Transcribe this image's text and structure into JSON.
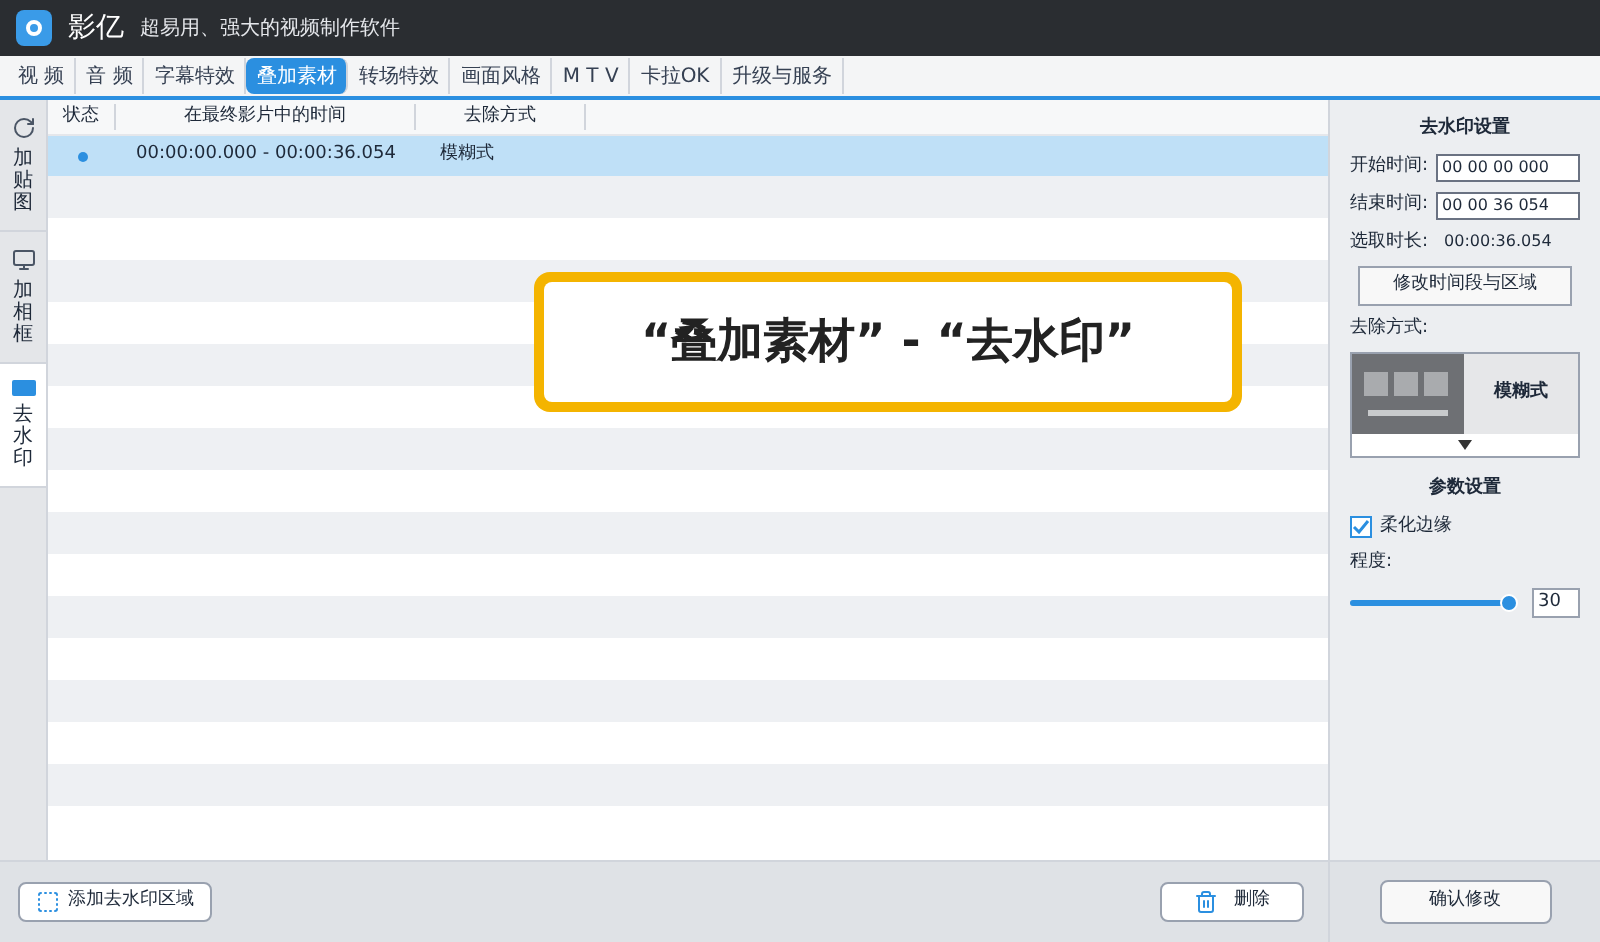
{
  "window": {
    "title": "影亿",
    "subtitle": "超易用、强大的视频制作软件"
  },
  "tabs": [
    {
      "label": "视 频",
      "selected": false
    },
    {
      "label": "音 频",
      "selected": false
    },
    {
      "label": "字幕特效",
      "selected": false
    },
    {
      "label": "叠加素材",
      "selected": true
    },
    {
      "label": "转场特效",
      "selected": false
    },
    {
      "label": "画面风格",
      "selected": false
    },
    {
      "label": "M T V",
      "selected": false
    },
    {
      "label": "卡拉OK",
      "selected": false
    },
    {
      "label": "升级与服务",
      "selected": false
    }
  ],
  "side_tabs": [
    {
      "label": "加贴图",
      "selected": false,
      "kind": "sticker"
    },
    {
      "label": "加相框",
      "selected": false,
      "kind": "frame"
    },
    {
      "label": "去水印",
      "selected": true,
      "kind": "watermark"
    }
  ],
  "table": {
    "columns": [
      "状态",
      "在最终影片中的时间",
      "去除方式"
    ],
    "rows": [
      {
        "time": "00:00:00.000 - 00:00:36.054",
        "method": "模糊式",
        "selected": true
      }
    ]
  },
  "callout": "“叠加素材” - “去水印”",
  "panel": {
    "title": "去水印设置",
    "start_label": "开始时间:",
    "start_value": "00 00 00 000",
    "end_label": "结束时间:",
    "end_value": "00 00 36 054",
    "duration_label": "选取时长:",
    "duration_value": "00:00:36.054",
    "modify_button": "修改时间段与区域",
    "method_label": "去除方式:",
    "method_value": "模糊式",
    "params_title": "参数设置",
    "soften_label": "柔化边缘",
    "soften_checked": true,
    "degree_label": "程度:",
    "degree": {
      "level": 0.95,
      "value": "30"
    },
    "confirm_button": "确认修改"
  },
  "bottom": {
    "add_button": "添加去水印区域",
    "delete_button": "删除"
  }
}
